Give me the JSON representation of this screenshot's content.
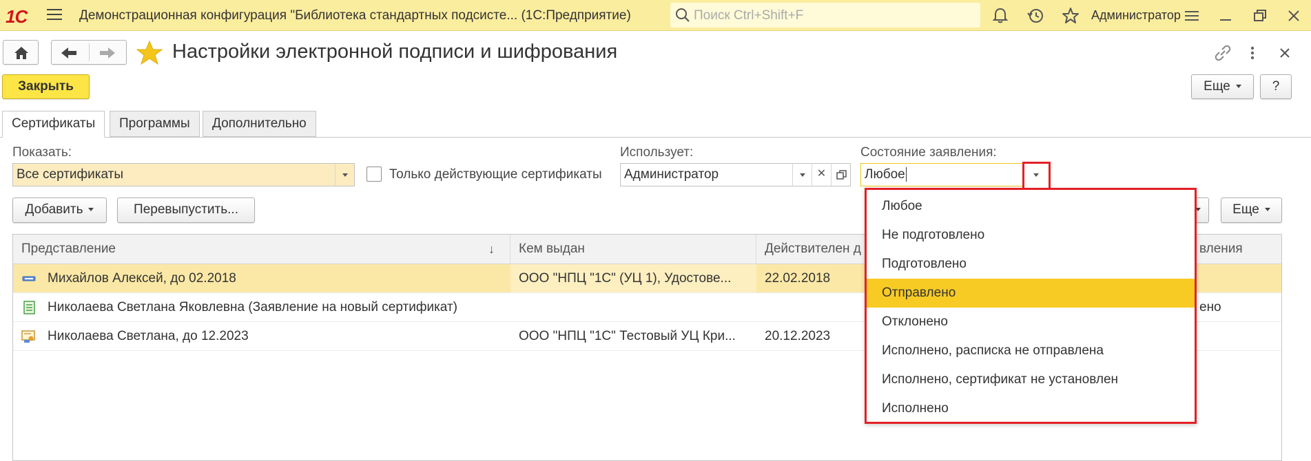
{
  "app": {
    "logo": "1С",
    "title": "Демонстрационная конфигурация \"Библиотека стандартных подсисте...   (1С:Предприятие)",
    "search_placeholder": "Поиск Ctrl+Shift+F",
    "user": "Администратор"
  },
  "form": {
    "title": "Настройки электронной подписи и шифрования",
    "close_label": "Закрыть",
    "more_label": "Еще",
    "help_label": "?"
  },
  "tabs": [
    {
      "label": "Сертификаты",
      "active": true
    },
    {
      "label": "Программы",
      "active": false
    },
    {
      "label": "Дополнительно",
      "active": false
    }
  ],
  "filters": {
    "show_label": "Показать:",
    "show_value": "Все сертификаты",
    "only_valid_label": "Только действующие сертификаты",
    "only_valid_checked": false,
    "uses_label": "Использует:",
    "uses_value": "Администратор",
    "status_label": "Состояние заявления:",
    "status_value": "Любое"
  },
  "toolbar": {
    "add_label": "Добавить",
    "reissue_label": "Перевыпустить...",
    "more_label": "Еще"
  },
  "table": {
    "columns": [
      "Представление",
      "Кем выдан",
      "Действителен д",
      "влениявления"
    ],
    "column_labels": {
      "c1": "Представление",
      "c2": "Кем выдан",
      "c3": "Действителен д",
      "c4": "вления"
    },
    "rows": [
      {
        "name": "Михайлов Алексей, до 02.2018",
        "issuer": "ООО \"НПЦ \"1С\" (УЦ 1), Удостове...",
        "valid": "22.02.2018",
        "status": "",
        "selected": true,
        "icon": "certificate-key-icon"
      },
      {
        "name": "Николаева Светлана Яковлевна (Заявление на новый сертификат)",
        "issuer": "",
        "valid": "",
        "status": "ено",
        "selected": false,
        "icon": "application-document-icon"
      },
      {
        "name": "Николаева Светлана, до 12.2023",
        "issuer": "ООО \"НПЦ \"1С\" Тестовый УЦ Кри...",
        "valid": "20.12.2023",
        "status": "",
        "selected": false,
        "icon": "certificate-user-icon"
      }
    ]
  },
  "dropdown": {
    "items": [
      "Любое",
      "Не подготовлено",
      "Подготовлено",
      "Отправлено",
      "Отклонено",
      "Исполнено, расписка не отправлена",
      "Исполнено, сертификат не установлен",
      "Исполнено"
    ],
    "highlighted_index": 3
  },
  "colors": {
    "topbar": "#fbed9e",
    "accent_yellow": "#fce545",
    "selected_row": "#fbe8a6",
    "highlight": "#f8cb24",
    "red_frame": "#e32026"
  }
}
